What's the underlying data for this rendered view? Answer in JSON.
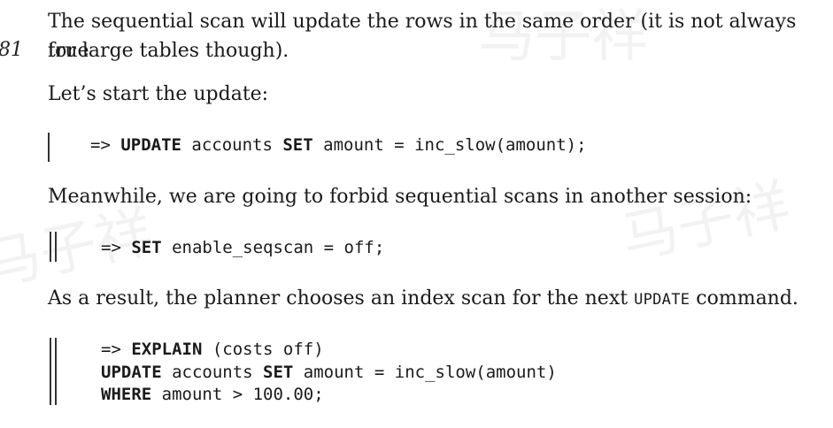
{
  "page_number": "81",
  "paragraphs": {
    "p1_line1": "The sequential scan will update the rows in the same order (it is not always true",
    "p1_line2": "for large tables though).",
    "p2": "Let’s start the update:",
    "p3": "Meanwhile, we are going to forbid sequential scans in another session:",
    "p4_before": "As a result, the planner chooses an index scan for the next ",
    "p4_keyword": "UPDATE",
    "p4_after": " command."
  },
  "code1": {
    "prompt": "=> ",
    "kw1": "UPDATE",
    "t1": " accounts ",
    "kw2": "SET",
    "t2": " amount = inc_slow(amount);"
  },
  "code2": {
    "prompt": "=> ",
    "kw1": "SET",
    "t1": " enable_seqscan = off;"
  },
  "code3": {
    "l1_prompt": "=> ",
    "l1_kw": "EXPLAIN",
    "l1_rest": " (costs off)",
    "l2_kw1": "UPDATE",
    "l2_t1": " accounts ",
    "l2_kw2": "SET",
    "l2_t2": " amount = inc_slow(amount)",
    "l3_kw": "WHERE",
    "l3_rest": " amount > 100.00;"
  }
}
